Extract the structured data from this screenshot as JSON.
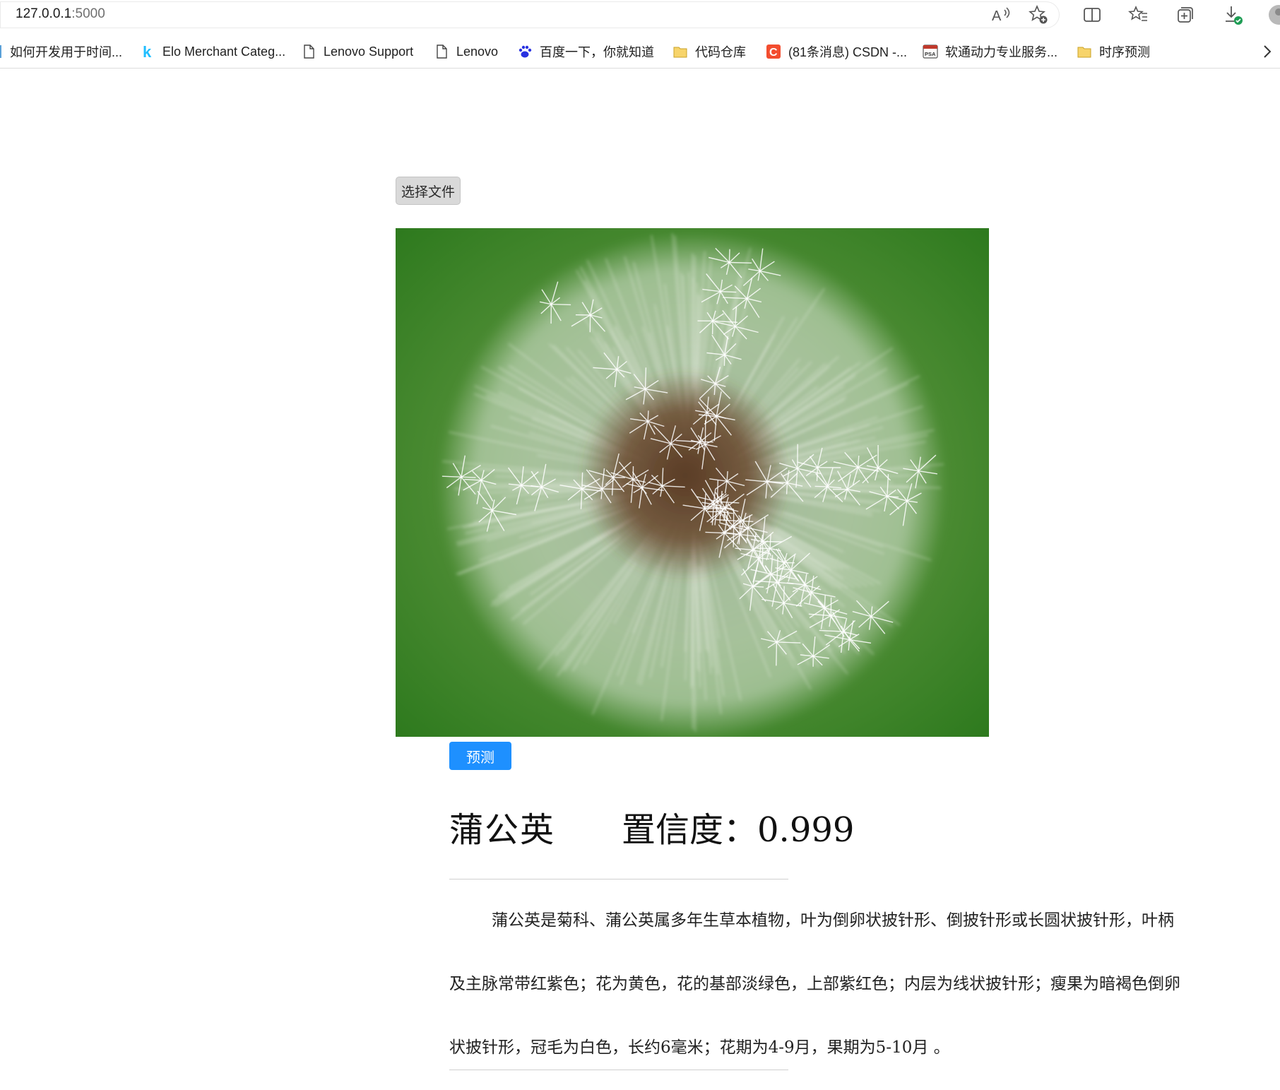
{
  "browser": {
    "url_host": "127.0.0.1",
    "url_port": ":5000",
    "toolbar_icons": [
      "read-aloud-icon",
      "add-favorite-icon",
      "split-screen-icon",
      "favorites-icon",
      "collections-icon",
      "downloads-icon",
      "profile-avatar-icon"
    ]
  },
  "favorites": [
    {
      "label": "如何开发用于时间...",
      "icon": "page-icon"
    },
    {
      "label": "Elo Merchant Categ...",
      "icon": "kaggle-k-icon"
    },
    {
      "label": "Lenovo Support",
      "icon": "page-icon"
    },
    {
      "label": "Lenovo",
      "icon": "page-icon"
    },
    {
      "label": "百度一下，你就知道",
      "icon": "baidu-paw-icon"
    },
    {
      "label": "代码仓库",
      "icon": "folder-icon"
    },
    {
      "label": "(81条消息) CSDN -...",
      "icon": "csdn-c-icon"
    },
    {
      "label": "软通动力专业服务...",
      "icon": "psa-icon"
    },
    {
      "label": "时序预测",
      "icon": "folder-icon"
    }
  ],
  "page": {
    "file_button_label": "选择文件",
    "image_subject": "dandelion-seed-head-photo",
    "predict_button_label": "预测",
    "result": {
      "class_name": "蒲公英",
      "confidence_label": "置信度：",
      "confidence_value": "0.999"
    },
    "description": "蒲公英是菊科、蒲公英属多年生草本植物，叶为倒卵状披针形、倒披针形或长圆状披针形，叶柄及主脉常带红紫色；花为黄色，花的基部淡绿色，上部紫红色；内层为线状披针形；瘦果为暗褐色倒卵状披针形，冠毛为白色，长约6毫米；花期为4-9月，果期为5-10月 。"
  },
  "colors": {
    "predict_button": "#1e90ff",
    "file_button": "#d9d9d9",
    "image_background_green": "#3f8a2a"
  }
}
